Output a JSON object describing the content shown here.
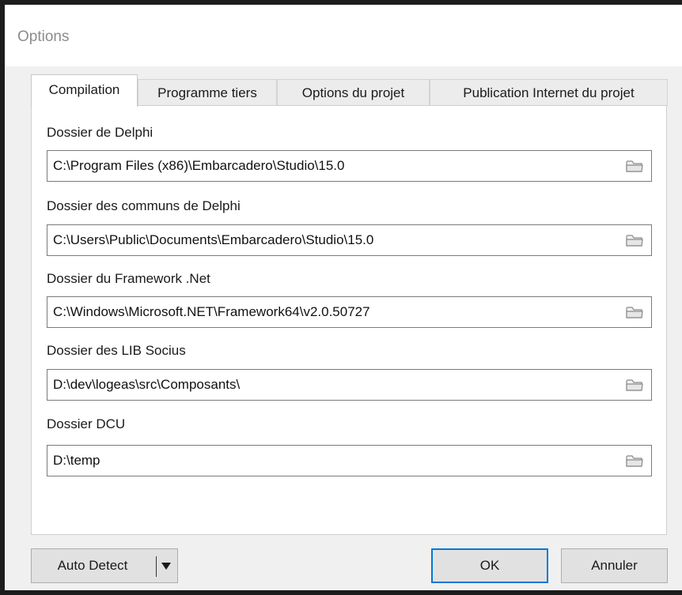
{
  "window": {
    "title": "Options"
  },
  "tabs": [
    {
      "label": "Compilation",
      "active": true
    },
    {
      "label": "Programme tiers",
      "active": false
    },
    {
      "label": "Options du projet",
      "active": false
    },
    {
      "label": "Publication Internet du projet",
      "active": false
    }
  ],
  "fields": [
    {
      "label": "Dossier de Delphi",
      "value": "C:\\Program Files (x86)\\Embarcadero\\Studio\\15.0",
      "button_icon": "folder-icon"
    },
    {
      "label": "Dossier des communs de Delphi",
      "value": "C:\\Users\\Public\\Documents\\Embarcadero\\Studio\\15.0",
      "button_icon": "folder-icon"
    },
    {
      "label": "Dossier du Framework .Net",
      "value": "C:\\Windows\\Microsoft.NET\\Framework64\\v2.0.50727",
      "button_icon": "folder-icon"
    },
    {
      "label": "Dossier des LIB Socius",
      "value": "D:\\dev\\logeas\\src\\Composants\\",
      "button_icon": "folder-icon"
    },
    {
      "label": "Dossier DCU",
      "value": "D:\\temp",
      "button_icon": "folder-icon"
    }
  ],
  "buttons": {
    "auto_detect": "Auto Detect",
    "ok": "OK",
    "cancel": "Annuler"
  },
  "colors": {
    "window_bg": "#f0f0f0",
    "panel_bg": "#ffffff",
    "default_button_border": "#0078d7",
    "title_text": "#8c8c8c"
  }
}
